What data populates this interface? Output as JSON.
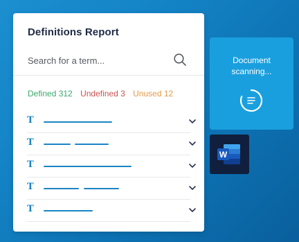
{
  "panel": {
    "title": "Definitions Report",
    "search_placeholder": "Search for a term...",
    "stats": {
      "defined_label": "Defined 312",
      "undefined_label": "Undefined 3",
      "unused_label": "Unused 12"
    },
    "rows": [
      {
        "icon": "T"
      },
      {
        "icon": "T"
      },
      {
        "icon": "T"
      },
      {
        "icon": "T"
      },
      {
        "icon": "T"
      }
    ]
  },
  "scanning_card": {
    "line1": "Document",
    "line2": "scanning..."
  },
  "colors": {
    "accent": "#1a84c4",
    "defined": "#3aa86b",
    "undefined": "#c9524f",
    "unused": "#e39b4a",
    "card": "#1a9fde",
    "word_tile": "#0f1f3d"
  },
  "icons": {
    "search": "search-icon",
    "expand": "chevron-down-icon",
    "term": "term-t-icon",
    "spinner": "loading-spinner-icon",
    "word": "word-icon"
  }
}
